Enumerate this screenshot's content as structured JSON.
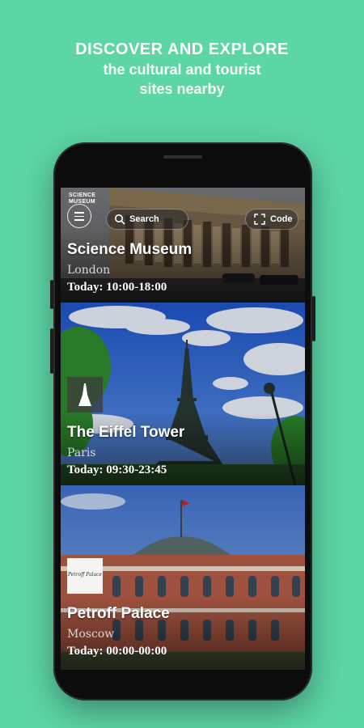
{
  "promo": {
    "headline": "DISCOVER AND EXPLORE",
    "subline_1": "the cultural and tourist",
    "subline_2": "sites nearby"
  },
  "topbar": {
    "menu_icon": "hamburger-menu-icon",
    "search_label": "Search",
    "search_icon": "search-icon",
    "code_label": "Code",
    "code_icon": "scan-frame-icon"
  },
  "places": [
    {
      "name": "Science Museum",
      "city": "London",
      "hours": "Today: 10:00-18:00",
      "logo_text_1": "SCIENCE",
      "logo_text_2": "MUSEUM"
    },
    {
      "name": "The Eiffel Tower",
      "city": "Paris",
      "hours": "Today: 09:30-23:45"
    },
    {
      "name": "Petroff Palace",
      "city": "Moscow",
      "hours": "Today: 00:00-00:00",
      "logo_text_1": "Petroff Palace"
    }
  ],
  "colors": {
    "background": "#5dd6a6",
    "phone_body": "#0c0c0c"
  }
}
